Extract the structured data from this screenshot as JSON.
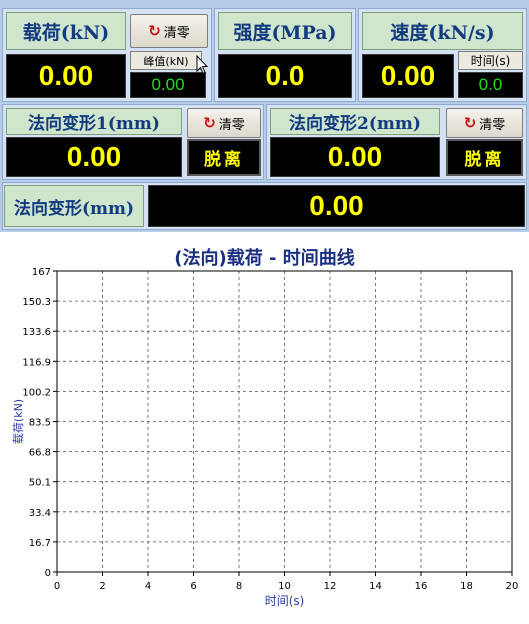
{
  "load": {
    "label": "载荷(kN)",
    "value": "0.00",
    "zero_label": "清零",
    "peak_label": "峰值(kN)",
    "peak_value": "0.00"
  },
  "strength": {
    "label": "强度(MPa)",
    "value": "0.0"
  },
  "speed": {
    "label": "速度(kN/s)",
    "value": "0.00",
    "time_label": "时间(s)",
    "time_value": "0.0"
  },
  "deform1": {
    "label": "法向变形1(mm)",
    "value": "0.00",
    "zero_label": "清零",
    "detach_label": "脱离"
  },
  "deform2": {
    "label": "法向变形2(mm)",
    "value": "0.00",
    "zero_label": "清零",
    "detach_label": "脱离"
  },
  "deform": {
    "label": "法向变形(mm)",
    "value": "0.00"
  },
  "colors": {
    "display_bg": "#000000",
    "display_text": "#ffff00",
    "small_display_text": "#22dd22",
    "label_bg": "#cfe6cc",
    "title_color": "#1a2f80",
    "zero_icon": "#d01010"
  },
  "icons": {
    "zero": "refresh-icon",
    "cursor": "mouse-pointer-icon"
  },
  "chart_data": {
    "type": "line",
    "title": "(法向)载荷 - 时间曲线",
    "xlabel": "时间(s)",
    "ylabel": "载荷(kN)",
    "xlim": [
      0,
      20
    ],
    "ylim": [
      0,
      167
    ],
    "x_ticks": [
      "0",
      "2",
      "4",
      "6",
      "8",
      "10",
      "12",
      "14",
      "16",
      "18",
      "20"
    ],
    "y_ticks": [
      "0",
      "16.7",
      "33.4",
      "50.1",
      "66.8",
      "83.5",
      "100.2",
      "116.9",
      "133.6",
      "150.3",
      "167"
    ],
    "grid": true,
    "series": []
  }
}
